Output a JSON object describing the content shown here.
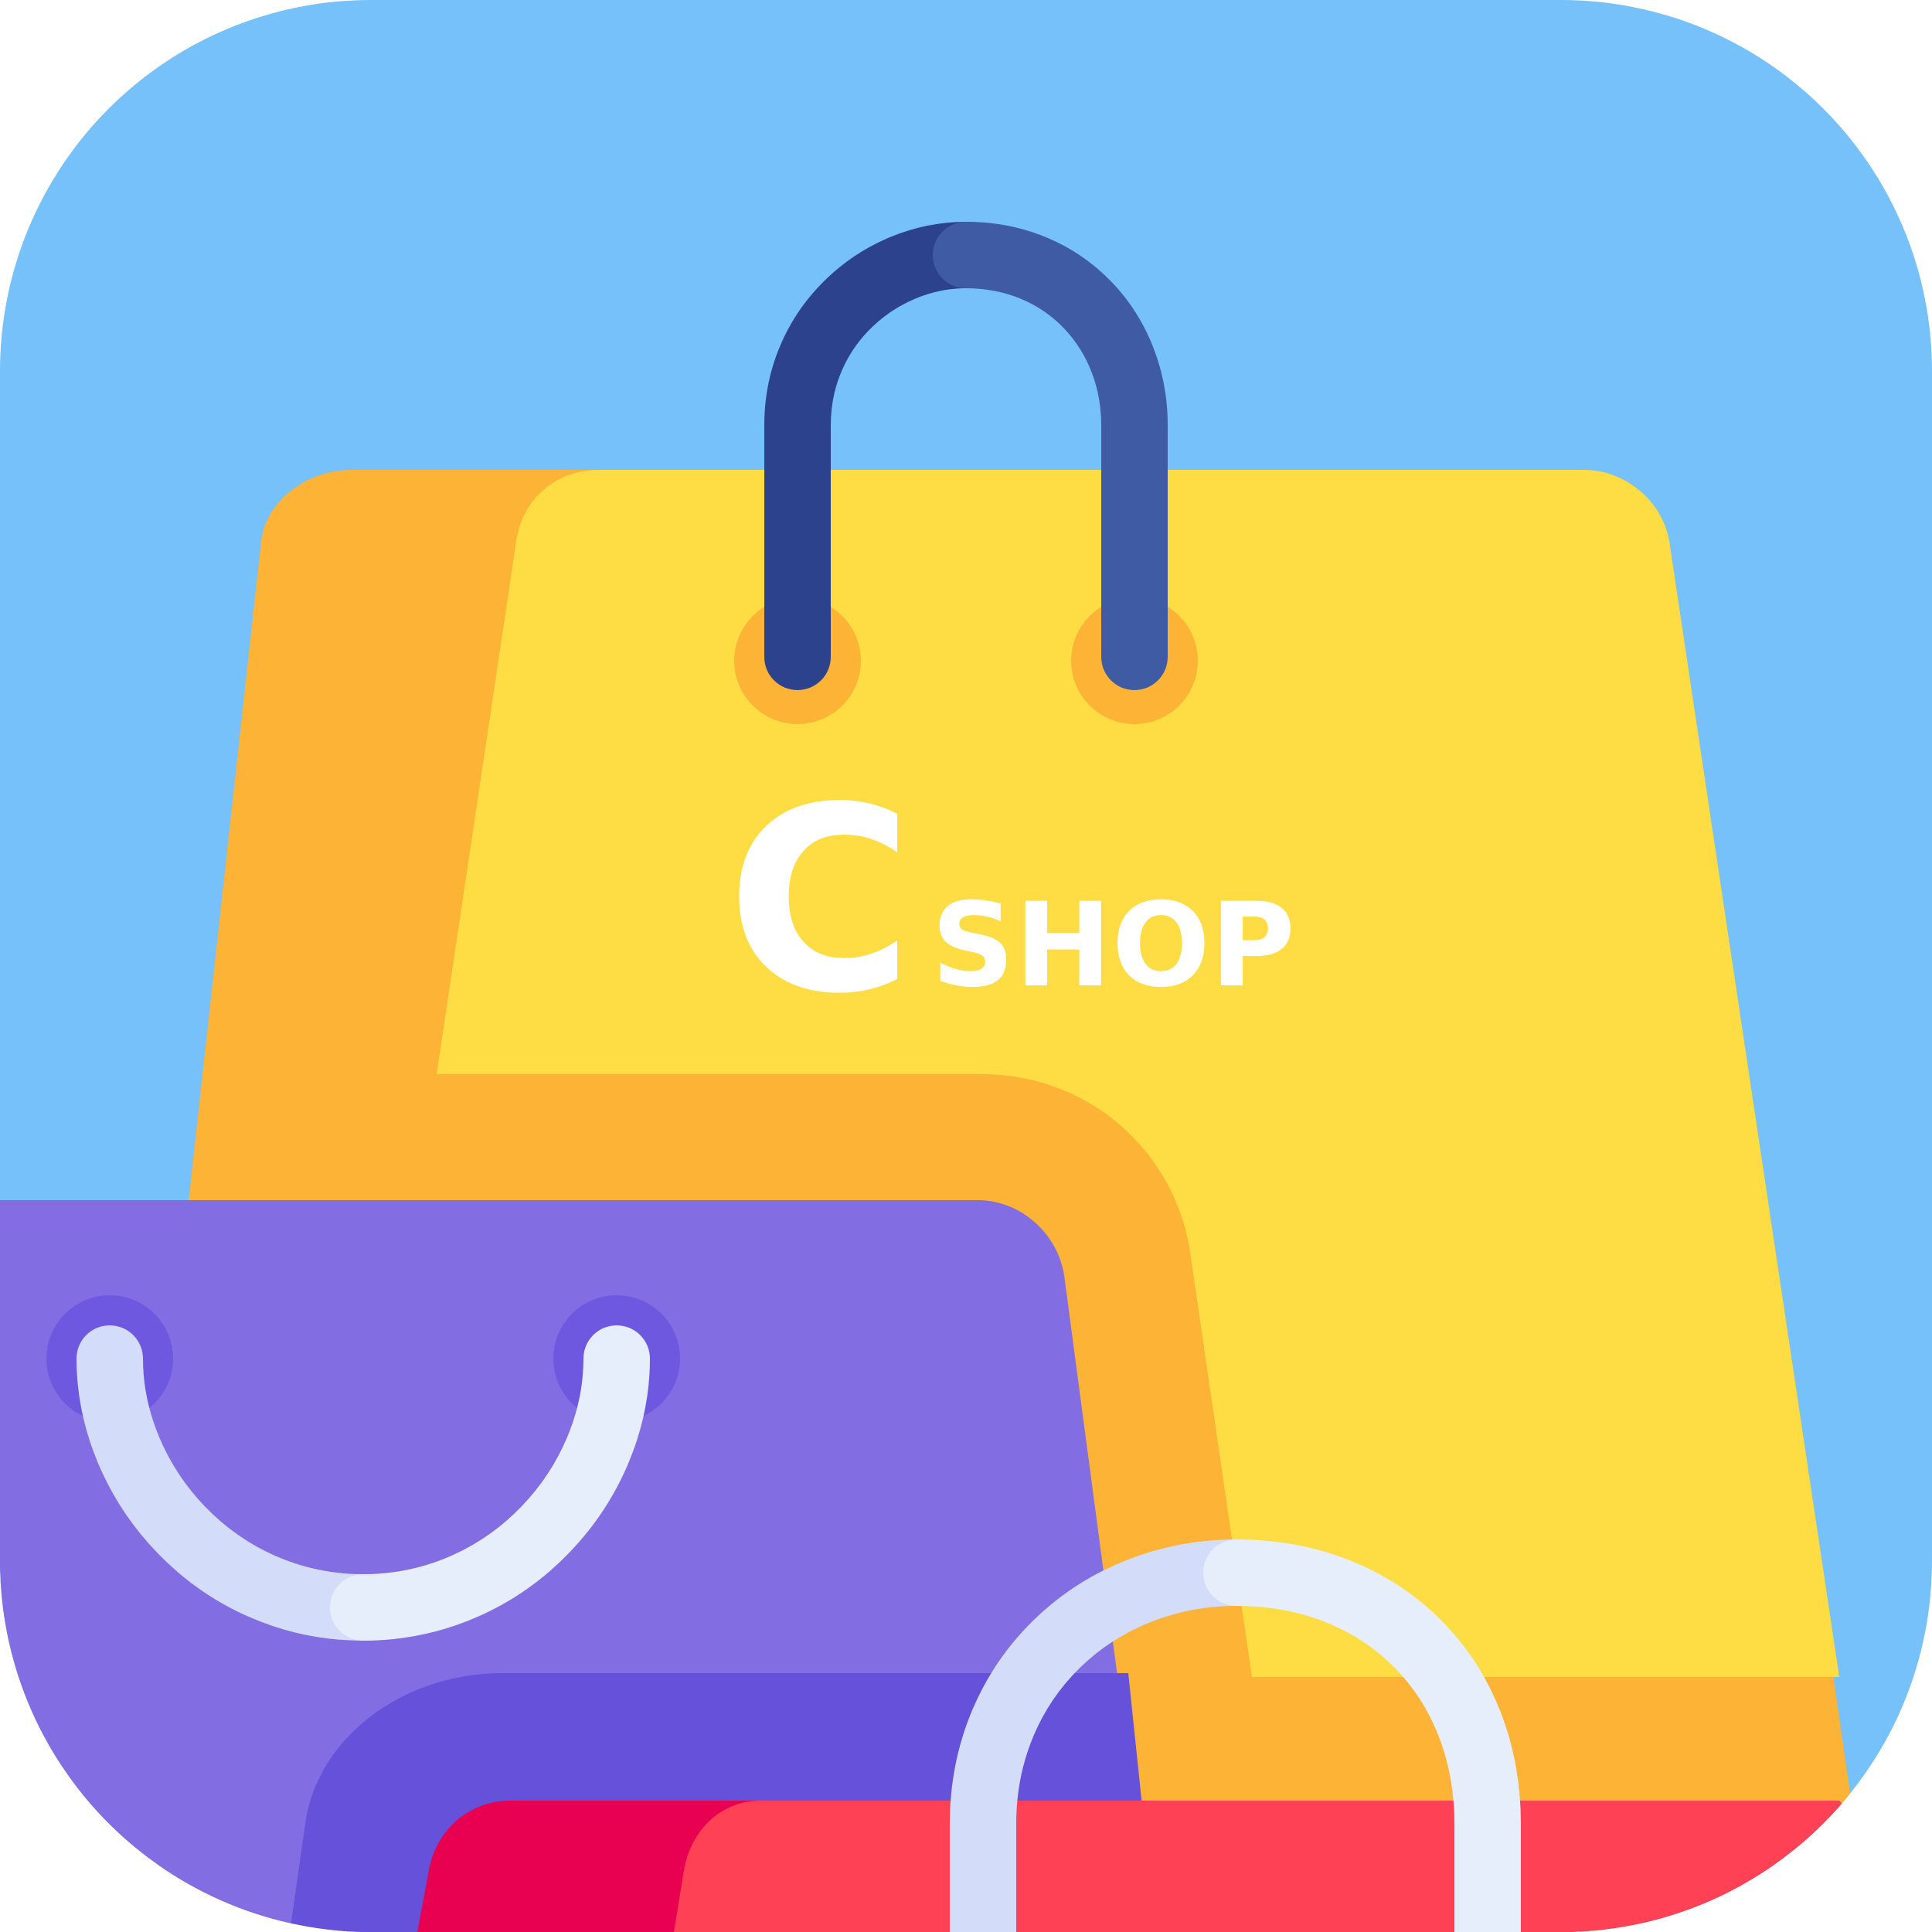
{
  "icon": {
    "name": "shopping-bags-app-icon",
    "brand": {
      "initial": "C",
      "word": "SHOP"
    },
    "colors": {
      "background": "#76C1F9",
      "yellow_bag": "#FDDC44",
      "yellow_bag_shade": "#FCB336",
      "navy_handle_dark": "#2C428C",
      "navy_handle_light": "#3E5BA4",
      "purple_bag": "#826DE2",
      "purple_bag_shade": "#6651DA",
      "purple_ring": "#6E58E0",
      "white_handle_light": "#E7EEFB",
      "white_handle_shade": "#D3DCF8",
      "red_bag": "#FF4156",
      "red_bag_shade": "#E80150"
    },
    "icons": [
      "yellow-shopping-bag-icon",
      "purple-shopping-bag-icon",
      "red-shopping-bag-icon"
    ]
  }
}
